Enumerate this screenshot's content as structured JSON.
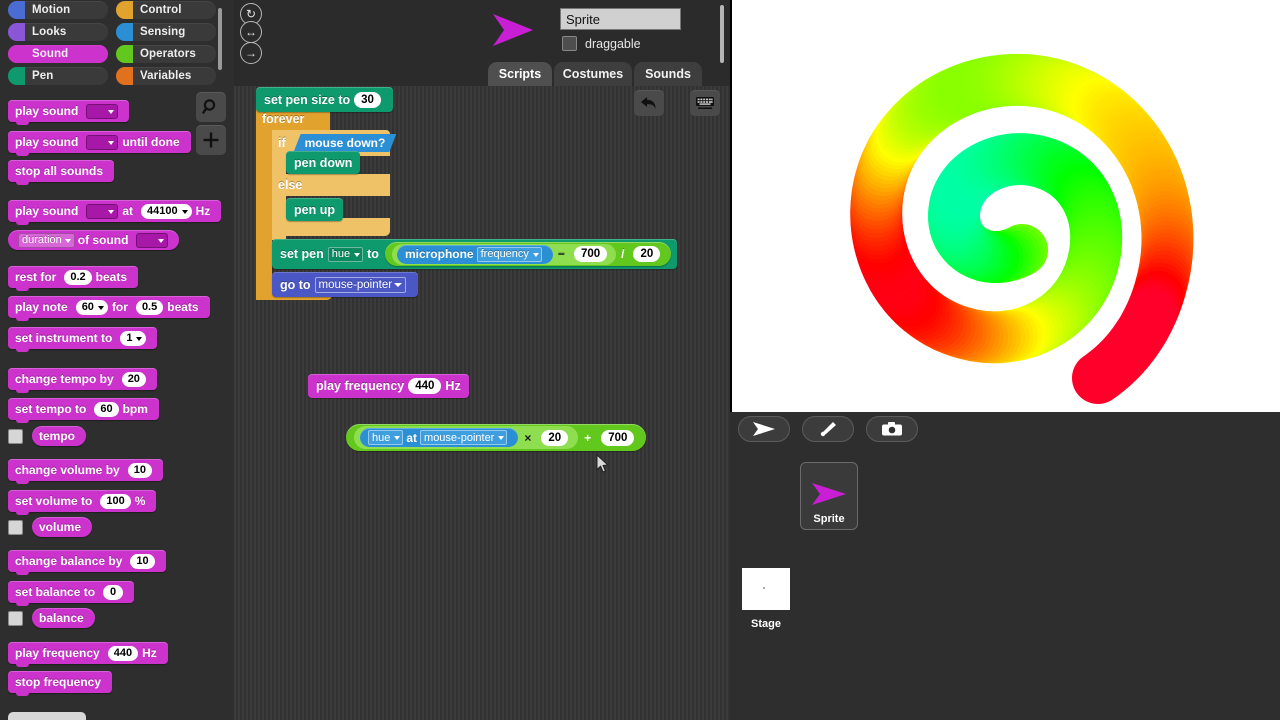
{
  "categories": [
    {
      "name": "Motion",
      "color": "#4a6cd4",
      "selected": false
    },
    {
      "name": "Control",
      "color": "#e1a32e",
      "selected": false
    },
    {
      "name": "Looks",
      "color": "#8a55d7",
      "selected": false
    },
    {
      "name": "Sensing",
      "color": "#2b8fd6",
      "selected": false
    },
    {
      "name": "Sound",
      "color": "#cc33cc",
      "selected": true
    },
    {
      "name": "Operators",
      "color": "#63c81e",
      "selected": false
    },
    {
      "name": "Pen",
      "color": "#0e9a6c",
      "selected": false
    },
    {
      "name": "Variables",
      "color": "#e2711d",
      "selected": false
    }
  ],
  "palette_tools": [
    {
      "name": "search-icon",
      "glyph": "⌕"
    },
    {
      "name": "plus-icon",
      "glyph": "+"
    }
  ],
  "palette_blocks": [
    {
      "id": "play-sound",
      "parts": [
        {
          "t": "label",
          "v": "play sound"
        },
        {
          "t": "inputdrop"
        }
      ]
    },
    {
      "id": "play-sound-until-done",
      "parts": [
        {
          "t": "label",
          "v": "play sound"
        },
        {
          "t": "inputdrop"
        },
        {
          "t": "label",
          "v": "until done"
        }
      ]
    },
    {
      "id": "stop-all-sounds",
      "parts": [
        {
          "t": "label",
          "v": "stop all sounds"
        }
      ]
    },
    {
      "id": "play-sound-at-hz",
      "parts": [
        {
          "t": "label",
          "v": "play sound"
        },
        {
          "t": "inputdrop"
        },
        {
          "t": "label",
          "v": "at"
        },
        {
          "t": "oval-drop",
          "v": "44100"
        },
        {
          "t": "label",
          "v": "Hz"
        }
      ]
    },
    {
      "id": "duration-of-sound",
      "reporter": true,
      "parts": [
        {
          "t": "selrect",
          "v": "duration"
        },
        {
          "t": "label",
          "v": "of sound"
        },
        {
          "t": "inputdrop"
        }
      ]
    },
    {
      "id": "rest-for-beats",
      "parts": [
        {
          "t": "label",
          "v": "rest for"
        },
        {
          "t": "oval",
          "v": "0.2"
        },
        {
          "t": "label",
          "v": "beats"
        }
      ]
    },
    {
      "id": "play-note-for-beats",
      "parts": [
        {
          "t": "label",
          "v": "play note"
        },
        {
          "t": "oval-drop",
          "v": "60"
        },
        {
          "t": "label",
          "v": "for"
        },
        {
          "t": "oval",
          "v": "0.5"
        },
        {
          "t": "label",
          "v": "beats"
        }
      ]
    },
    {
      "id": "set-instrument-to",
      "parts": [
        {
          "t": "label",
          "v": "set instrument to"
        },
        {
          "t": "oval-drop",
          "v": "1"
        }
      ]
    },
    {
      "id": "change-tempo-by",
      "parts": [
        {
          "t": "label",
          "v": "change tempo by"
        },
        {
          "t": "oval",
          "v": "20"
        }
      ]
    },
    {
      "id": "set-tempo-to-bpm",
      "parts": [
        {
          "t": "label",
          "v": "set tempo to"
        },
        {
          "t": "oval",
          "v": "60"
        },
        {
          "t": "label",
          "v": "bpm"
        }
      ]
    },
    {
      "id": "tempo-watcher",
      "watcher": true,
      "reporter": true,
      "parts": [
        {
          "t": "label",
          "v": "tempo"
        }
      ]
    },
    {
      "id": "change-volume-by",
      "parts": [
        {
          "t": "label",
          "v": "change volume by"
        },
        {
          "t": "oval",
          "v": "10"
        }
      ]
    },
    {
      "id": "set-volume-to",
      "parts": [
        {
          "t": "label",
          "v": "set volume to"
        },
        {
          "t": "oval",
          "v": "100"
        },
        {
          "t": "label",
          "v": "%"
        }
      ]
    },
    {
      "id": "volume-watcher",
      "watcher": true,
      "reporter": true,
      "parts": [
        {
          "t": "label",
          "v": "volume"
        }
      ]
    },
    {
      "id": "change-balance-by",
      "parts": [
        {
          "t": "label",
          "v": "change balance by"
        },
        {
          "t": "oval",
          "v": "10"
        }
      ]
    },
    {
      "id": "set-balance-to",
      "parts": [
        {
          "t": "label",
          "v": "set balance to"
        },
        {
          "t": "oval",
          "v": "0"
        }
      ]
    },
    {
      "id": "balance-watcher",
      "watcher": true,
      "reporter": true,
      "parts": [
        {
          "t": "label",
          "v": "balance"
        }
      ]
    },
    {
      "id": "play-frequency-hz",
      "parts": [
        {
          "t": "label",
          "v": "play frequency"
        },
        {
          "t": "oval",
          "v": "440"
        },
        {
          "t": "label",
          "v": "Hz"
        }
      ]
    },
    {
      "id": "stop-frequency",
      "parts": [
        {
          "t": "label",
          "v": "stop frequency"
        }
      ]
    }
  ],
  "sprite_header": {
    "rotation_buttons": [
      "↻",
      "↔",
      "→"
    ],
    "name_value": "Sprite",
    "draggable_label": "draggable",
    "draggable_checked": false
  },
  "tabs": [
    {
      "label": "Scripts",
      "active": true
    },
    {
      "label": "Costumes",
      "active": false
    },
    {
      "label": "Sounds",
      "active": false
    }
  ],
  "canvas_tools": [
    {
      "name": "undo-icon",
      "glyph": "↶"
    },
    {
      "name": "keyboard-icon",
      "glyph": "⌨"
    }
  ],
  "script": {
    "set_pen_size": {
      "label": "set pen size to",
      "value": "30"
    },
    "forever": "forever",
    "if_label": "if",
    "mouse_down": "mouse down?",
    "pen_down": "pen down",
    "else_label": "else",
    "pen_up": "pen up",
    "set_pen": {
      "prefix": "set pen",
      "attribute": "hue",
      "to": "to"
    },
    "microphone": {
      "label": "microphone",
      "option": "frequency"
    },
    "minus_op": "−",
    "minus_value": "700",
    "divide_op": "/",
    "divide_value": "20",
    "go_to": {
      "label": "go to",
      "target": "mouse-pointer"
    }
  },
  "loose_blocks": {
    "play_frequency": {
      "label": "play frequency",
      "value": "440",
      "unit": "Hz"
    },
    "hue_reporter": {
      "attribute": "hue",
      "at": "at",
      "target": "mouse-pointer",
      "multiply_op": "×",
      "multiply_value": "20",
      "plus_op": "+",
      "plus_value": "700"
    }
  },
  "sprite_pane": {
    "toolbar": [
      {
        "name": "new-sprite-icon",
        "glyph": "arrow"
      },
      {
        "name": "paint-sprite-icon",
        "glyph": "brush"
      },
      {
        "name": "camera-sprite-icon",
        "glyph": "camera"
      }
    ],
    "sprites": [
      {
        "name": "Sprite",
        "selected": true
      }
    ],
    "stage_label": "Stage"
  },
  "stage_drawing": {
    "description": "rainbow spiral drawn with thick round pen dots",
    "background": "#ffffff"
  }
}
